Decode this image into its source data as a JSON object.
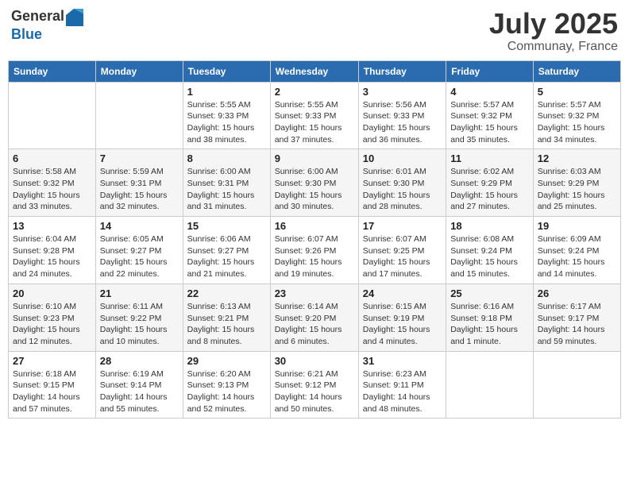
{
  "logo": {
    "general": "General",
    "blue": "Blue"
  },
  "title": {
    "month": "July 2025",
    "location": "Communay, France"
  },
  "headers": [
    "Sunday",
    "Monday",
    "Tuesday",
    "Wednesday",
    "Thursday",
    "Friday",
    "Saturday"
  ],
  "weeks": [
    [
      {
        "day": "",
        "sunrise": "",
        "sunset": "",
        "daylight": ""
      },
      {
        "day": "",
        "sunrise": "",
        "sunset": "",
        "daylight": ""
      },
      {
        "day": "1",
        "sunrise": "Sunrise: 5:55 AM",
        "sunset": "Sunset: 9:33 PM",
        "daylight": "Daylight: 15 hours and 38 minutes."
      },
      {
        "day": "2",
        "sunrise": "Sunrise: 5:55 AM",
        "sunset": "Sunset: 9:33 PM",
        "daylight": "Daylight: 15 hours and 37 minutes."
      },
      {
        "day": "3",
        "sunrise": "Sunrise: 5:56 AM",
        "sunset": "Sunset: 9:33 PM",
        "daylight": "Daylight: 15 hours and 36 minutes."
      },
      {
        "day": "4",
        "sunrise": "Sunrise: 5:57 AM",
        "sunset": "Sunset: 9:32 PM",
        "daylight": "Daylight: 15 hours and 35 minutes."
      },
      {
        "day": "5",
        "sunrise": "Sunrise: 5:57 AM",
        "sunset": "Sunset: 9:32 PM",
        "daylight": "Daylight: 15 hours and 34 minutes."
      }
    ],
    [
      {
        "day": "6",
        "sunrise": "Sunrise: 5:58 AM",
        "sunset": "Sunset: 9:32 PM",
        "daylight": "Daylight: 15 hours and 33 minutes."
      },
      {
        "day": "7",
        "sunrise": "Sunrise: 5:59 AM",
        "sunset": "Sunset: 9:31 PM",
        "daylight": "Daylight: 15 hours and 32 minutes."
      },
      {
        "day": "8",
        "sunrise": "Sunrise: 6:00 AM",
        "sunset": "Sunset: 9:31 PM",
        "daylight": "Daylight: 15 hours and 31 minutes."
      },
      {
        "day": "9",
        "sunrise": "Sunrise: 6:00 AM",
        "sunset": "Sunset: 9:30 PM",
        "daylight": "Daylight: 15 hours and 30 minutes."
      },
      {
        "day": "10",
        "sunrise": "Sunrise: 6:01 AM",
        "sunset": "Sunset: 9:30 PM",
        "daylight": "Daylight: 15 hours and 28 minutes."
      },
      {
        "day": "11",
        "sunrise": "Sunrise: 6:02 AM",
        "sunset": "Sunset: 9:29 PM",
        "daylight": "Daylight: 15 hours and 27 minutes."
      },
      {
        "day": "12",
        "sunrise": "Sunrise: 6:03 AM",
        "sunset": "Sunset: 9:29 PM",
        "daylight": "Daylight: 15 hours and 25 minutes."
      }
    ],
    [
      {
        "day": "13",
        "sunrise": "Sunrise: 6:04 AM",
        "sunset": "Sunset: 9:28 PM",
        "daylight": "Daylight: 15 hours and 24 minutes."
      },
      {
        "day": "14",
        "sunrise": "Sunrise: 6:05 AM",
        "sunset": "Sunset: 9:27 PM",
        "daylight": "Daylight: 15 hours and 22 minutes."
      },
      {
        "day": "15",
        "sunrise": "Sunrise: 6:06 AM",
        "sunset": "Sunset: 9:27 PM",
        "daylight": "Daylight: 15 hours and 21 minutes."
      },
      {
        "day": "16",
        "sunrise": "Sunrise: 6:07 AM",
        "sunset": "Sunset: 9:26 PM",
        "daylight": "Daylight: 15 hours and 19 minutes."
      },
      {
        "day": "17",
        "sunrise": "Sunrise: 6:07 AM",
        "sunset": "Sunset: 9:25 PM",
        "daylight": "Daylight: 15 hours and 17 minutes."
      },
      {
        "day": "18",
        "sunrise": "Sunrise: 6:08 AM",
        "sunset": "Sunset: 9:24 PM",
        "daylight": "Daylight: 15 hours and 15 minutes."
      },
      {
        "day": "19",
        "sunrise": "Sunrise: 6:09 AM",
        "sunset": "Sunset: 9:24 PM",
        "daylight": "Daylight: 15 hours and 14 minutes."
      }
    ],
    [
      {
        "day": "20",
        "sunrise": "Sunrise: 6:10 AM",
        "sunset": "Sunset: 9:23 PM",
        "daylight": "Daylight: 15 hours and 12 minutes."
      },
      {
        "day": "21",
        "sunrise": "Sunrise: 6:11 AM",
        "sunset": "Sunset: 9:22 PM",
        "daylight": "Daylight: 15 hours and 10 minutes."
      },
      {
        "day": "22",
        "sunrise": "Sunrise: 6:13 AM",
        "sunset": "Sunset: 9:21 PM",
        "daylight": "Daylight: 15 hours and 8 minutes."
      },
      {
        "day": "23",
        "sunrise": "Sunrise: 6:14 AM",
        "sunset": "Sunset: 9:20 PM",
        "daylight": "Daylight: 15 hours and 6 minutes."
      },
      {
        "day": "24",
        "sunrise": "Sunrise: 6:15 AM",
        "sunset": "Sunset: 9:19 PM",
        "daylight": "Daylight: 15 hours and 4 minutes."
      },
      {
        "day": "25",
        "sunrise": "Sunrise: 6:16 AM",
        "sunset": "Sunset: 9:18 PM",
        "daylight": "Daylight: 15 hours and 1 minute."
      },
      {
        "day": "26",
        "sunrise": "Sunrise: 6:17 AM",
        "sunset": "Sunset: 9:17 PM",
        "daylight": "Daylight: 14 hours and 59 minutes."
      }
    ],
    [
      {
        "day": "27",
        "sunrise": "Sunrise: 6:18 AM",
        "sunset": "Sunset: 9:15 PM",
        "daylight": "Daylight: 14 hours and 57 minutes."
      },
      {
        "day": "28",
        "sunrise": "Sunrise: 6:19 AM",
        "sunset": "Sunset: 9:14 PM",
        "daylight": "Daylight: 14 hours and 55 minutes."
      },
      {
        "day": "29",
        "sunrise": "Sunrise: 6:20 AM",
        "sunset": "Sunset: 9:13 PM",
        "daylight": "Daylight: 14 hours and 52 minutes."
      },
      {
        "day": "30",
        "sunrise": "Sunrise: 6:21 AM",
        "sunset": "Sunset: 9:12 PM",
        "daylight": "Daylight: 14 hours and 50 minutes."
      },
      {
        "day": "31",
        "sunrise": "Sunrise: 6:23 AM",
        "sunset": "Sunset: 9:11 PM",
        "daylight": "Daylight: 14 hours and 48 minutes."
      },
      {
        "day": "",
        "sunrise": "",
        "sunset": "",
        "daylight": ""
      },
      {
        "day": "",
        "sunrise": "",
        "sunset": "",
        "daylight": ""
      }
    ]
  ]
}
